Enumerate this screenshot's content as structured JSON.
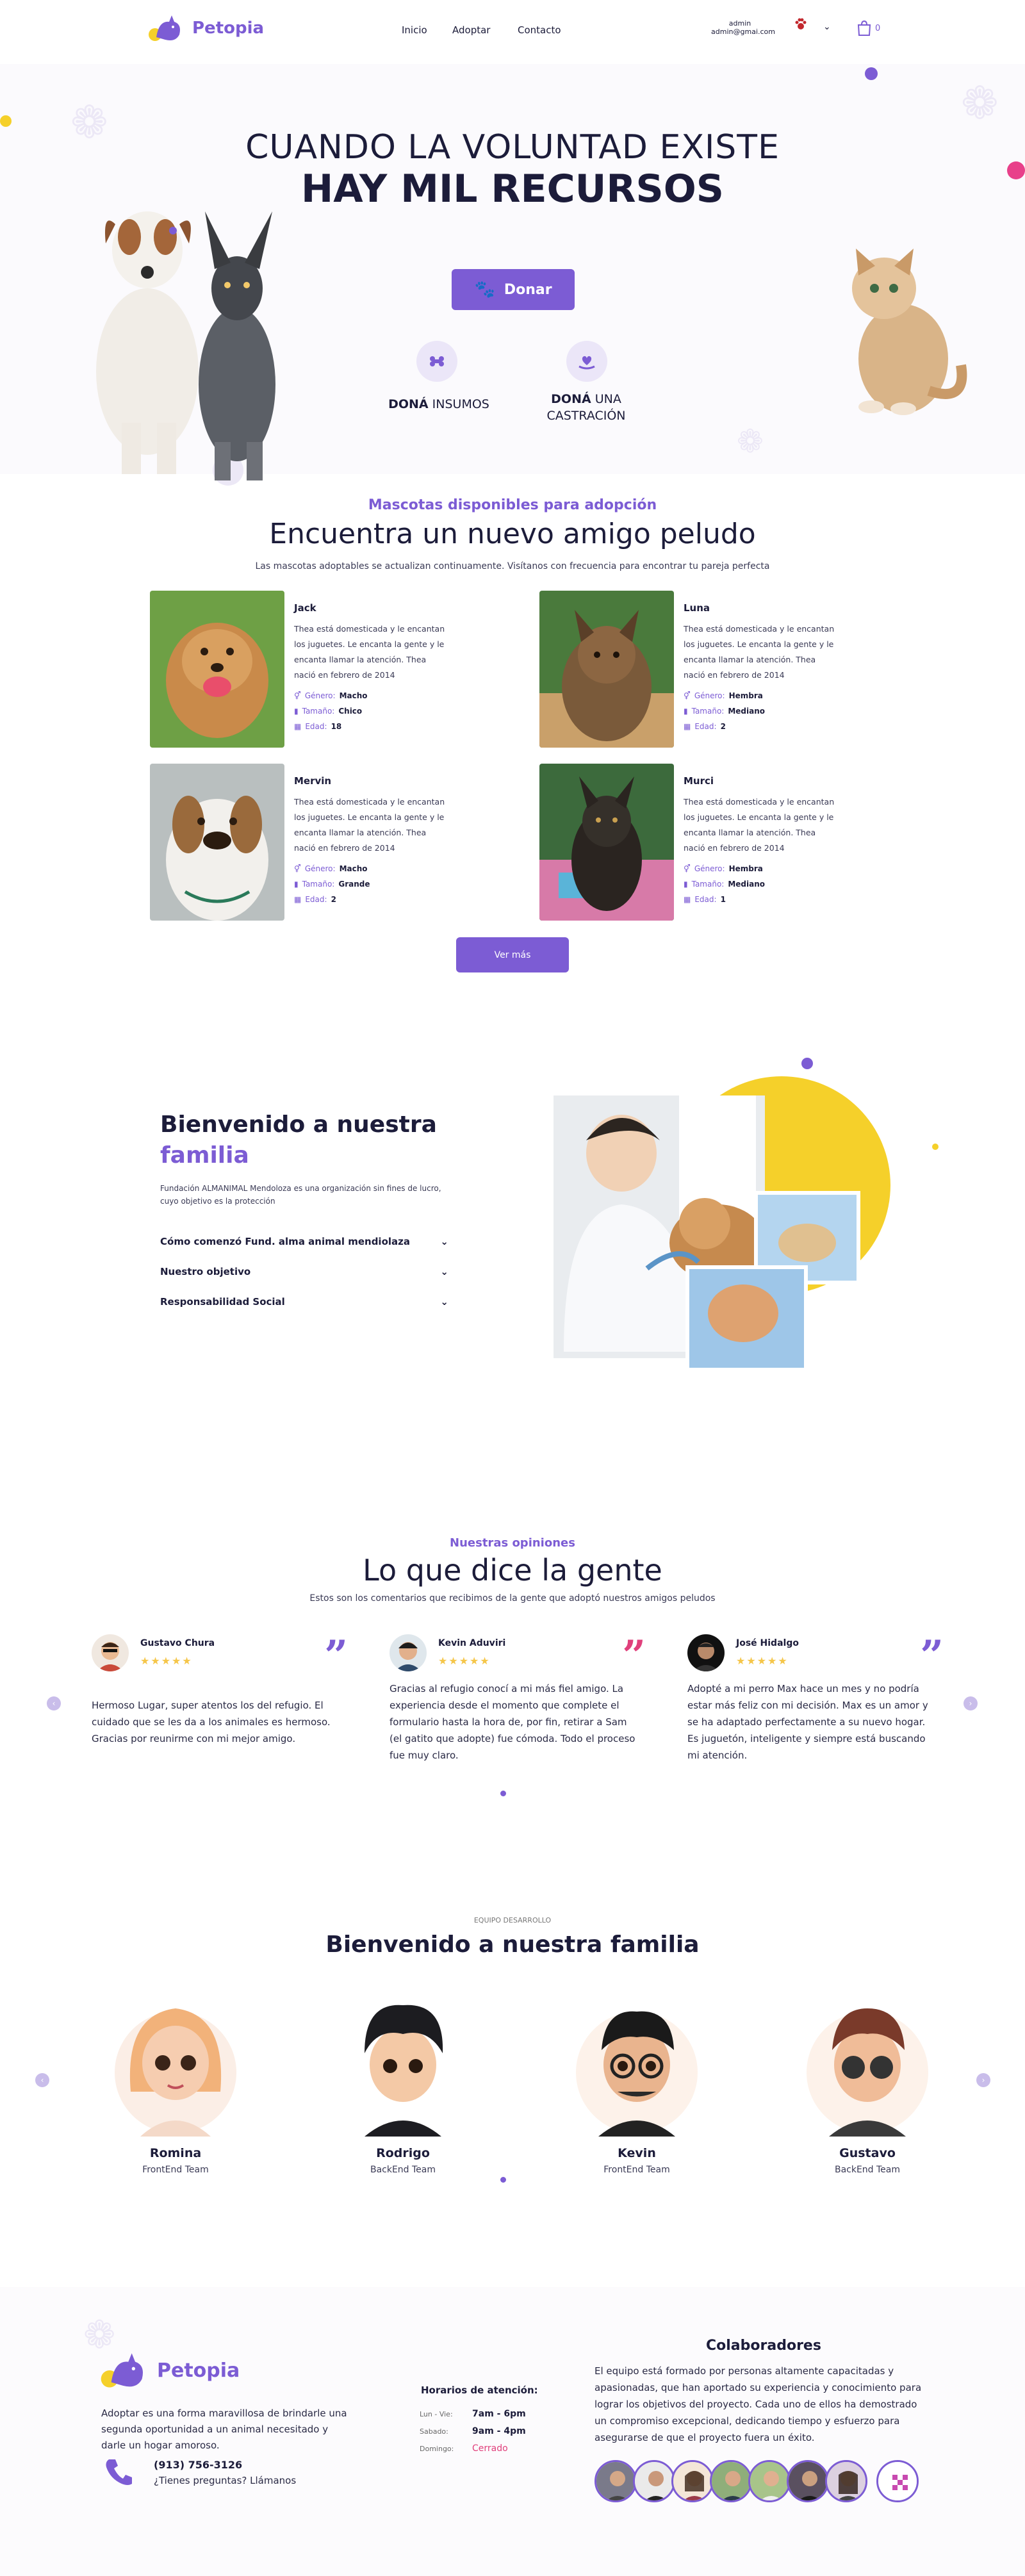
{
  "header": {
    "brand": "Petopia",
    "nav": [
      "Inicio",
      "Adoptar",
      "Contacto"
    ],
    "user_name": "admin",
    "user_email": "admin@gmai.com",
    "cart_count": "0",
    "brand_color": "#7c5cd4"
  },
  "hero": {
    "title_line1": "CUANDO LA VOLUNTAD EXISTE",
    "title_line2": "HAY MIL RECURSOS",
    "donate_label": "Donar",
    "option1_bold": "DONÁ",
    "option1_rest": " INSUMOS",
    "option2_bold": "DONÁ",
    "option2_rest": " UNA",
    "option2_line2": "CASTRACIÓN"
  },
  "adoption": {
    "kicker": "Mascotas disponibles para adopción",
    "title": "Encuentra un nuevo amigo peludo",
    "subtitle": "Las mascotas adoptables se actualizan continuamente. Visítanos con frecuencia para encontrar tu pareja perfecta",
    "gender_label": "Género:",
    "size_label": "Tamaño:",
    "age_label": "Edad:",
    "pets": [
      {
        "name": "Jack",
        "description": "Thea está domesticada y le encantan los juguetes. Le encanta la gente y le encanta llamar la atención. Thea nació en febrero de 2014",
        "gender": "Macho",
        "size": "Chico",
        "age": "18"
      },
      {
        "name": "Luna",
        "description": "Thea está domesticada y le encantan los juguetes. Le encanta la gente y le encanta llamar la atención. Thea nació en febrero de 2014",
        "gender": "Hembra",
        "size": "Mediano",
        "age": "2"
      },
      {
        "name": "Mervin",
        "description": "Thea está domesticada y le encantan los juguetes. Le encanta la gente y le encanta llamar la atención. Thea nació en febrero de 2014",
        "gender": "Macho",
        "size": "Grande",
        "age": "2"
      },
      {
        "name": "Murci",
        "description": "Thea está domesticada y le encantan los juguetes. Le encanta la gente y le encanta llamar la atención. Thea nació en febrero de 2014",
        "gender": "Hembra",
        "size": "Mediano",
        "age": "1"
      }
    ],
    "more_label": "Ver más"
  },
  "about": {
    "title_line1": "Bienvenido a nuestra",
    "title_line2": "familia",
    "description": "Fundación ALMANIMAL Mendoloza es una organización sin fines de lucro, cuyo objetivo es la protección",
    "accordion": [
      "Cómo comenzó Fund. alma animal mendiolaza",
      "Nuestro objetivo",
      "Responsabilidad Social"
    ]
  },
  "testimonials": {
    "kicker": "Nuestras opiniones",
    "title": "Lo que dice la gente",
    "subtitle": "Estos son los comentarios que recibimos de la gente que adoptó nuestros amigos peludos",
    "items": [
      {
        "name": "Gustavo Chura",
        "stars": "★★★★★",
        "text": "Hermoso Lugar, super atentos los del refugio. El cuidado que se les da a los animales es hermoso. Gracias por reunirme con mi mejor amigo.",
        "quote_color": "#7c5cd4"
      },
      {
        "name": "Kevin Aduviri",
        "stars": "★★★★★",
        "text": "Gracias al refugio conocí a mi más fiel amigo. La experiencia desde el momento que complete el formulario hasta la hora de, por fin, retirar a Sam (el gatito que adopte) fue cómoda. Todo el proceso fue muy claro.",
        "quote_color": "#e0407c"
      },
      {
        "name": "José Hidalgo",
        "stars": "★★★★★",
        "text": "Adopté a mi perro Max hace un mes y no podría estar más feliz con mi decisión. Max es un amor y se ha adaptado perfectamente a su nuevo hogar. Es juguetón, inteligente y siempre está buscando mi atención.",
        "quote_color": "#7c5cd4"
      }
    ]
  },
  "team": {
    "kicker": "EQUIPO DESARROLLO",
    "title": "Bienvenido a nuestra familia",
    "members": [
      {
        "name": "Romina",
        "role": "FrontEnd Team"
      },
      {
        "name": "Rodrigo",
        "role": "BackEnd Team"
      },
      {
        "name": "Kevin",
        "role": "FrontEnd Team"
      },
      {
        "name": "Gustavo",
        "role": "BackEnd Team"
      }
    ]
  },
  "footer": {
    "brand": "Petopia",
    "about": "Adoptar es una forma maravillosa de brindarle una segunda oportunidad a un animal necesitado y darle un hogar amoroso.",
    "phone": "(913) 756-3126",
    "phone_caption": "¿Tienes preguntas? Llámanos",
    "schedule_title": "Horarios de atención:",
    "schedule": [
      {
        "day": "Lun - Vie:",
        "hours": "7am - 6pm"
      },
      {
        "day": "Sabado:",
        "hours": "9am - 4pm"
      },
      {
        "day": "Domingo:",
        "hours": "Cerrado"
      }
    ],
    "collab_title": "Colaboradores",
    "collab_text": "El equipo está formado por personas altamente capacitadas y apasionadas, que han aportado su experiencia y conocimiento para lograr los objetivos del proyecto. Cada uno de ellos ha demostrado un compromiso excepcional, dedicando tiempo y esfuerzo para asegurarse de que el proyecto fuera un éxito.",
    "closed_color": "#e0407c"
  }
}
